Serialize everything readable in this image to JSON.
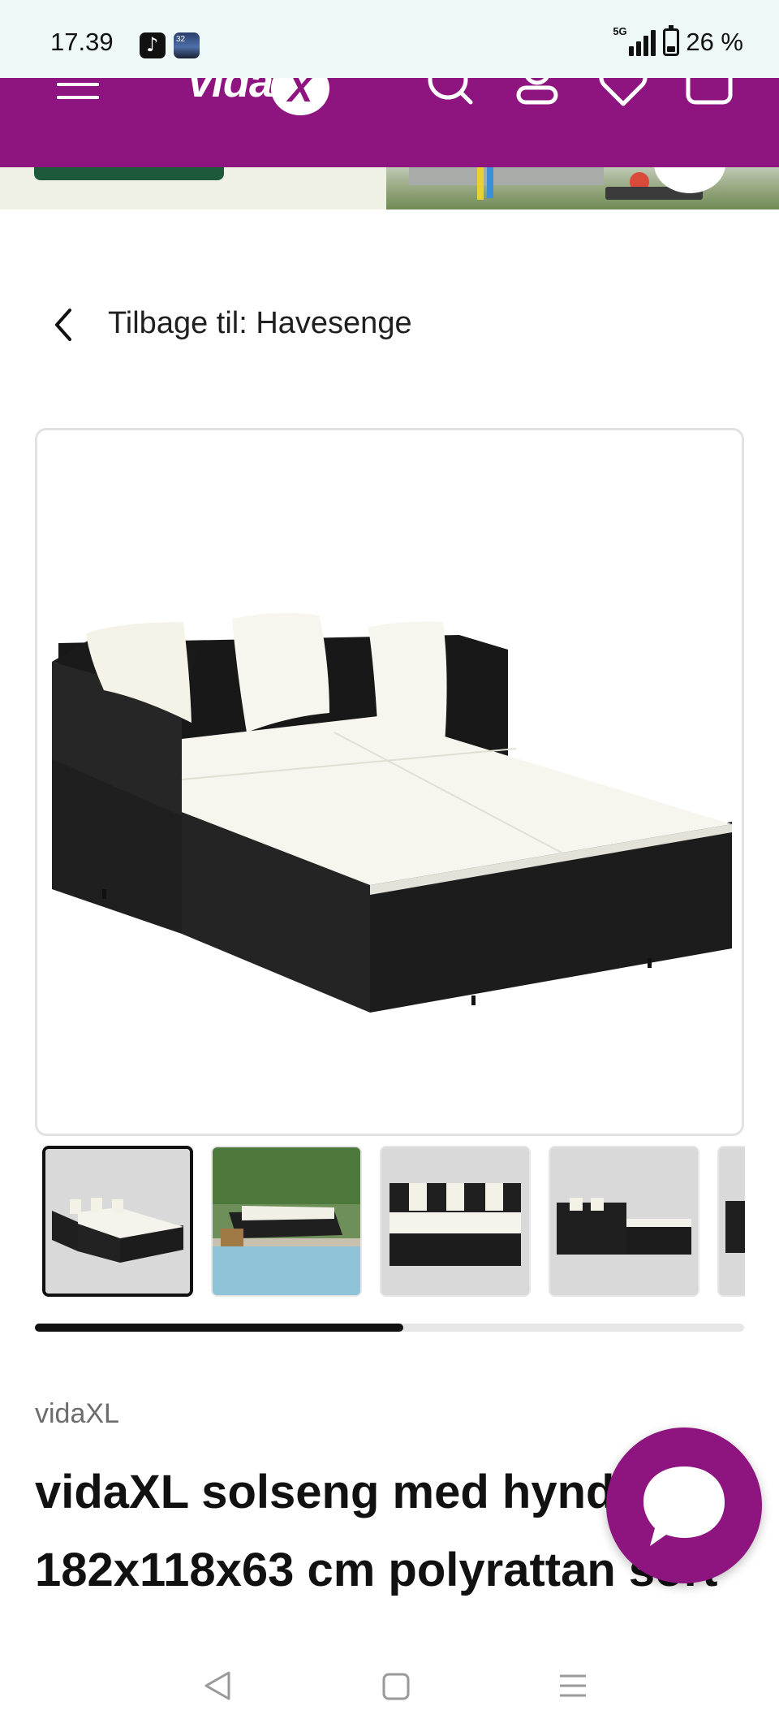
{
  "status_bar": {
    "time": "17.39",
    "network": "5G",
    "battery": "26 %",
    "battery_level": 0.26
  },
  "header": {
    "logo_text": "vidaXL",
    "icons": [
      "menu-icon",
      "search-icon",
      "account-icon",
      "wishlist-icon",
      "cart-icon"
    ],
    "brand_color": "#8e1580"
  },
  "breadcrumb": {
    "back_label": "Tilbage til: Havesenge"
  },
  "gallery": {
    "thumbnail_count": 5,
    "active_index": 0,
    "scroll_progress": 0.52
  },
  "product": {
    "brand": "vidaXL",
    "title": "vidaXL solseng med hynder 182x118x63 cm polyrattan sort"
  },
  "chat": {
    "icon": "chat-bubble-icon"
  },
  "nav": {
    "icons": [
      "back-icon",
      "home-icon",
      "recents-icon"
    ]
  }
}
